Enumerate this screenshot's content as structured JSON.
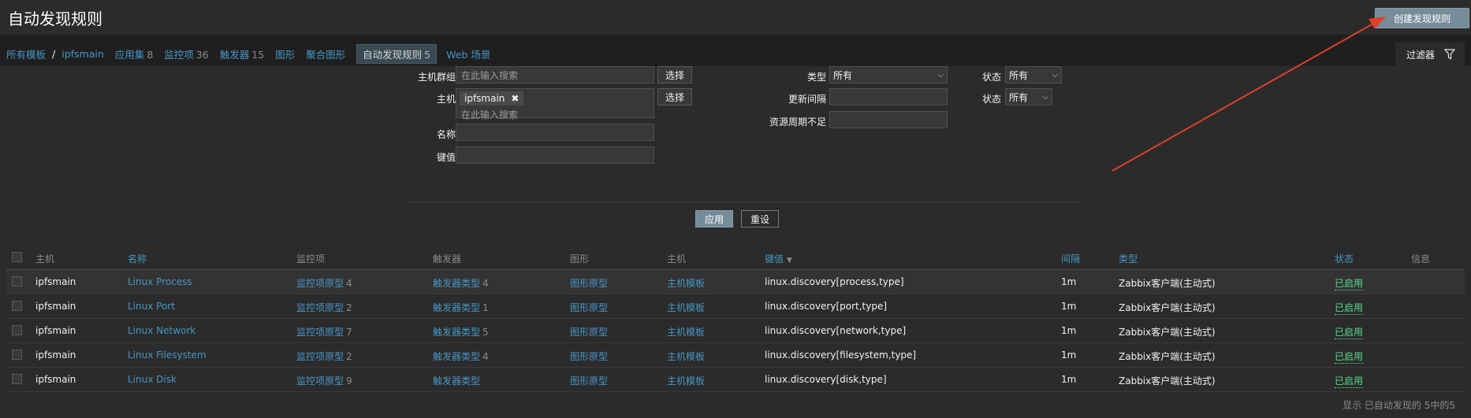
{
  "header": {
    "title": "自动发现规则",
    "create_label": "创建发现规则"
  },
  "breadcrumb": {
    "all_templates": "所有模板",
    "separator": "/",
    "template": "ipfsmain",
    "tabs": [
      {
        "label": "应用集",
        "count": "8"
      },
      {
        "label": "监控项",
        "count": "36"
      },
      {
        "label": "触发器",
        "count": "15"
      },
      {
        "label": "图形",
        "count": ""
      },
      {
        "label": "聚合图形",
        "count": ""
      },
      {
        "label": "自动发现规则",
        "count": "5",
        "active": true
      },
      {
        "label": "Web 场景",
        "count": ""
      }
    ]
  },
  "filter": {
    "tab_label": "过滤器",
    "host_group_label": "主机群组",
    "host_group_placeholder": "在此输入搜索",
    "select_label": "选择",
    "host_label": "主机",
    "host_tag": "ipfsmain",
    "host_placeholder": "在此输入搜索",
    "name_label": "名称",
    "key_label": "键值",
    "type_label": "类型",
    "type_value": "所有",
    "interval_label": "更新间隔",
    "history_label": "资源周期不足",
    "state_label": "状态",
    "state_value": "所有",
    "status_label": "状态",
    "status_value": "所有",
    "apply_label": "应用",
    "reset_label": "重设"
  },
  "table": {
    "headers": {
      "host": "主机",
      "name": "名称",
      "items": "监控项",
      "triggers": "触发器",
      "graphs": "图形",
      "hosts": "主机",
      "key": "键值",
      "interval": "间隔",
      "type": "类型",
      "status": "状态",
      "info": "信息"
    },
    "rows": [
      {
        "host": "ipfsmain",
        "name": "Linux Process",
        "items": "监控项原型",
        "items_count": "4",
        "triggers": "触发器类型",
        "triggers_count": "4",
        "graphs": "图形原型",
        "hosts": "主机模板",
        "key": "linux.discovery[process,type]",
        "interval": "1m",
        "type": "Zabbix客户端(主动式)",
        "status": "已启用"
      },
      {
        "host": "ipfsmain",
        "name": "Linux Port",
        "items": "监控项原型",
        "items_count": "2",
        "triggers": "触发器类型",
        "triggers_count": "1",
        "graphs": "图形原型",
        "hosts": "主机模板",
        "key": "linux.discovery[port,type]",
        "interval": "1m",
        "type": "Zabbix客户端(主动式)",
        "status": "已启用"
      },
      {
        "host": "ipfsmain",
        "name": "Linux Network",
        "items": "监控项原型",
        "items_count": "7",
        "triggers": "触发器类型",
        "triggers_count": "5",
        "graphs": "图形原型",
        "hosts": "主机模板",
        "key": "linux.discovery[network,type]",
        "interval": "1m",
        "type": "Zabbix客户端(主动式)",
        "status": "已启用"
      },
      {
        "host": "ipfsmain",
        "name": "Linux Filesystem",
        "items": "监控项原型",
        "items_count": "2",
        "triggers": "触发器类型",
        "triggers_count": "4",
        "graphs": "图形原型",
        "hosts": "主机模板",
        "key": "linux.discovery[filesystem,type]",
        "interval": "1m",
        "type": "Zabbix客户端(主动式)",
        "status": "已启用"
      },
      {
        "host": "ipfsmain",
        "name": "Linux Disk",
        "items": "监控项原型",
        "items_count": "9",
        "triggers": "触发器类型",
        "triggers_count": "",
        "graphs": "图形原型",
        "hosts": "主机模板",
        "key": "linux.discovery[disk,type]",
        "interval": "1m",
        "type": "Zabbix客户端(主动式)",
        "status": "已启用"
      }
    ],
    "footer": "显示 已自动发现的 5中的5"
  },
  "colors": {
    "link": "#4796c4",
    "enabled": "#59db8f",
    "button": "#768d99",
    "annotation_arrow": "#e0402a"
  }
}
